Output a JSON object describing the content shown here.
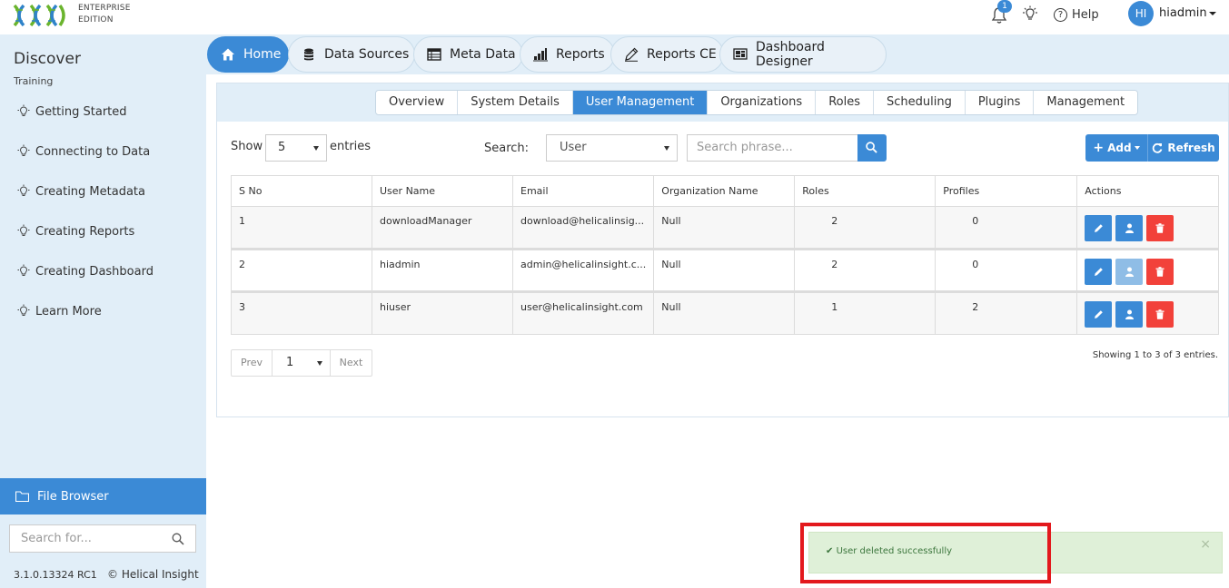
{
  "header": {
    "edition_line1": "ENTERPRISE",
    "edition_line2": "EDITION",
    "notification_count": "1",
    "help_label": "Help",
    "avatar_initials": "HI",
    "username": "hiadmin"
  },
  "sidebar": {
    "title": "Discover",
    "subtitle": "Training",
    "items": [
      {
        "label": "Getting Started"
      },
      {
        "label": "Connecting to Data"
      },
      {
        "label": "Creating Metadata"
      },
      {
        "label": "Creating Reports"
      },
      {
        "label": "Creating Dashboard"
      },
      {
        "label": "Learn More"
      }
    ],
    "file_browser": "File Browser",
    "search_placeholder": "Search for...",
    "version": "3.1.0.13324 RC1",
    "copyright": "© Helical Insight"
  },
  "main_tabs": [
    {
      "label": "Home",
      "icon": "home-icon",
      "active": true
    },
    {
      "label": "Data Sources",
      "icon": "database-icon"
    },
    {
      "label": "Meta Data",
      "icon": "table-icon"
    },
    {
      "label": "Reports",
      "icon": "bar-chart-icon"
    },
    {
      "label": "Reports CE",
      "icon": "pencil-icon"
    },
    {
      "label": "Dashboard Designer",
      "icon": "dashboard-icon"
    }
  ],
  "sub_tabs": [
    {
      "label": "Overview"
    },
    {
      "label": "System Details"
    },
    {
      "label": "User Management",
      "active": true
    },
    {
      "label": "Organizations"
    },
    {
      "label": "Roles"
    },
    {
      "label": "Scheduling"
    },
    {
      "label": "Plugins"
    },
    {
      "label": "Management"
    }
  ],
  "controls": {
    "show_label": "Show",
    "show_value": "5",
    "entries_label": "entries",
    "search_label": "Search:",
    "search_field": "User",
    "search_placeholder": "Search phrase...",
    "add_label": "Add",
    "refresh_label": "Refresh"
  },
  "table": {
    "columns": [
      "S No",
      "User Name",
      "Email",
      "Organization Name",
      "Roles",
      "Profiles",
      "Actions"
    ],
    "rows": [
      {
        "sno": "1",
        "username": "downloadManager",
        "email": "download@helicalinsig...",
        "org": "Null",
        "roles": "2",
        "profiles": "0"
      },
      {
        "sno": "2",
        "username": "hiadmin",
        "email": "admin@helicalinsight.c...",
        "org": "Null",
        "roles": "2",
        "profiles": "0"
      },
      {
        "sno": "3",
        "username": "hiuser",
        "email": "user@helicalinsight.com",
        "org": "Null",
        "roles": "1",
        "profiles": "2"
      }
    ]
  },
  "pagination": {
    "prev": "Prev",
    "page": "1",
    "next": "Next",
    "summary": "Showing 1 to 3 of 3 entries."
  },
  "toast": {
    "message": "User deleted successfully",
    "close": "×"
  },
  "colors": {
    "accent": "#3b8ad6",
    "danger": "#f2413a",
    "success_bg": "#dff0d8",
    "highlight": "#e3191d"
  }
}
